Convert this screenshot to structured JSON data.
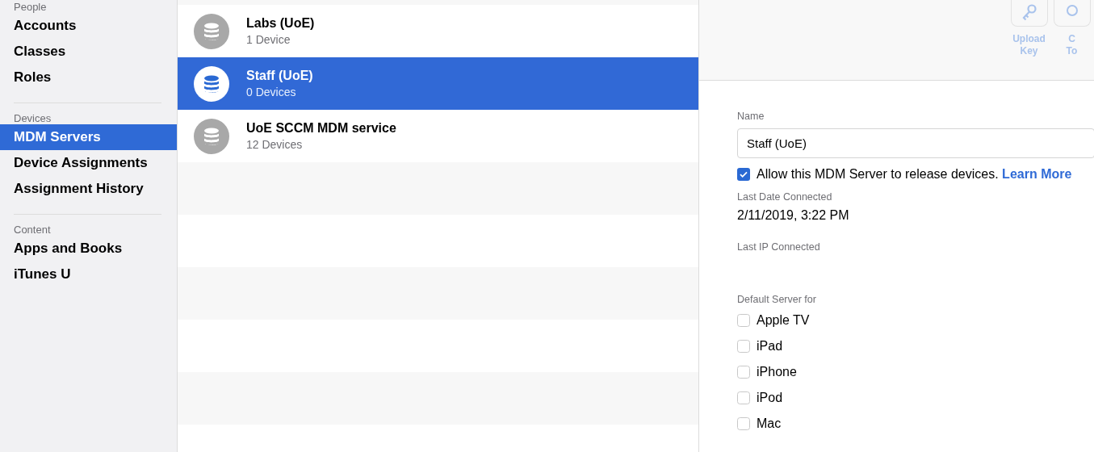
{
  "sidebar": {
    "sections": [
      {
        "title": "People",
        "items": [
          {
            "label": "Accounts",
            "selected": false
          },
          {
            "label": "Classes",
            "selected": false
          },
          {
            "label": "Roles",
            "selected": false
          }
        ]
      },
      {
        "title": "Devices",
        "items": [
          {
            "label": "MDM Servers",
            "selected": true
          },
          {
            "label": "Device Assignments",
            "selected": false
          },
          {
            "label": "Assignment History",
            "selected": false
          }
        ]
      },
      {
        "title": "Content",
        "items": [
          {
            "label": "Apps and Books",
            "selected": false
          },
          {
            "label": "iTunes U",
            "selected": false
          }
        ]
      }
    ]
  },
  "servers": [
    {
      "name": "Labs (UoE)",
      "count": "1 Device",
      "selected": false
    },
    {
      "name": "Staff (UoE)",
      "count": "0 Devices",
      "selected": true
    },
    {
      "name": "UoE SCCM MDM service",
      "count": "12 Devices",
      "selected": false
    }
  ],
  "toolbar": [
    {
      "kind": "key",
      "label": [
        "Upload",
        "Key"
      ],
      "disabled": true
    },
    {
      "kind": "other",
      "label": [
        "C",
        "To"
      ],
      "disabled": true
    }
  ],
  "detail": {
    "name_label": "Name",
    "name_value": "Staff (UoE)",
    "allow_release": {
      "label": "Allow this MDM Server to release devices.",
      "link": "Learn More",
      "checked": true
    },
    "last_date_label": "Last Date Connected",
    "last_date": "2/11/2019, 3:22 PM",
    "last_ip_label": "Last IP Connected",
    "default_label": "Default Server for",
    "defaults": [
      {
        "label": "Apple TV",
        "checked": false
      },
      {
        "label": "iPad",
        "checked": false
      },
      {
        "label": "iPhone",
        "checked": false
      },
      {
        "label": "iPod",
        "checked": false
      },
      {
        "label": "Mac",
        "checked": false
      }
    ]
  }
}
